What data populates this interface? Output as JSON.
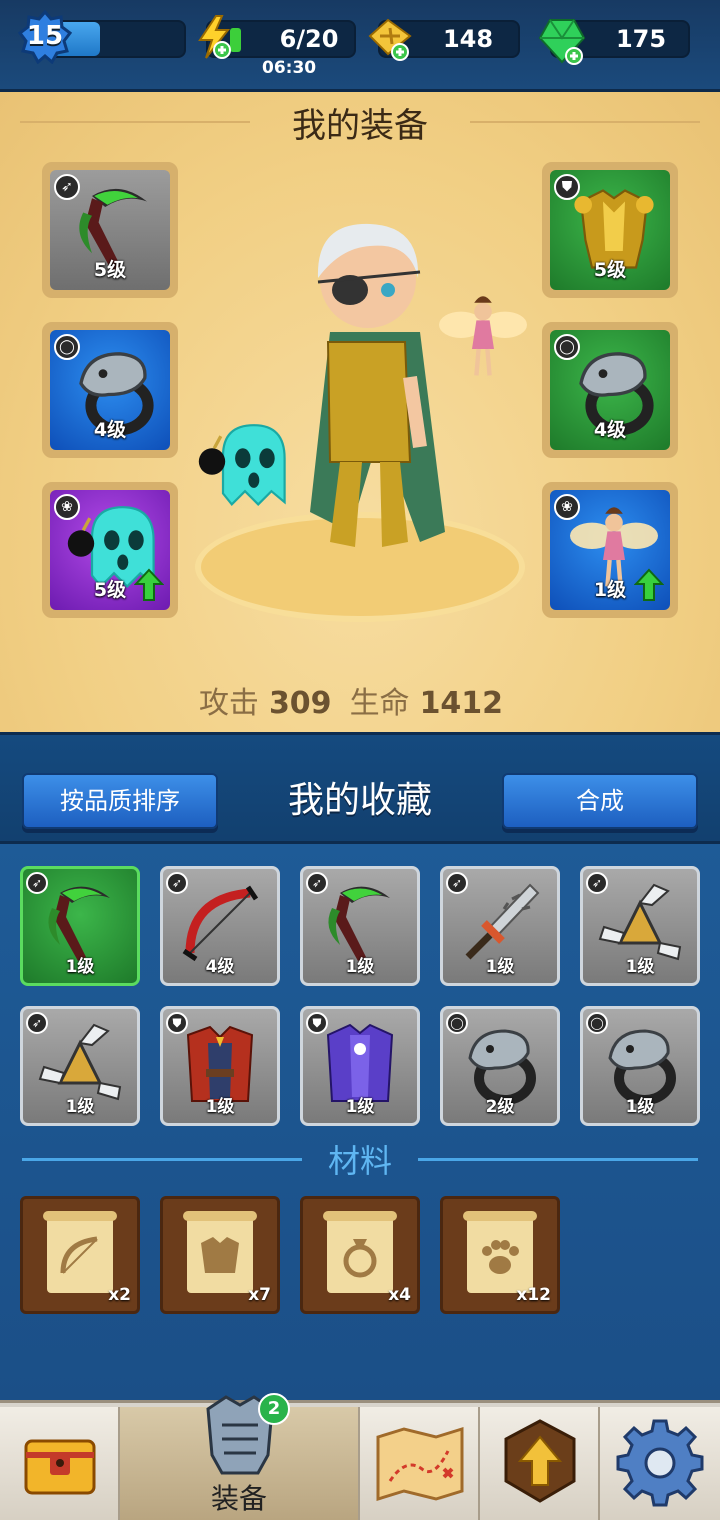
{
  "topbar": {
    "level": "15",
    "level_progress": 0.41,
    "energy": "6/20",
    "energy_timer": "06:30",
    "energy_fill": 0.3,
    "tickets": "148",
    "gems": "175",
    "icons": [
      "level-star-icon",
      "energy-bolt-icon",
      "ticket-icon",
      "gem-icon"
    ]
  },
  "equipment": {
    "title": "我的装备",
    "slots": [
      {
        "level": "5级",
        "rarity": "gray",
        "item": "green-scythe",
        "type": "weapon"
      },
      {
        "level": "5级",
        "rarity": "green",
        "item": "gold-armor",
        "type": "armor"
      },
      {
        "level": "4级",
        "rarity": "blue",
        "item": "snake-ring",
        "type": "ring"
      },
      {
        "level": "4级",
        "rarity": "green",
        "item": "eagle-ring",
        "type": "ring"
      },
      {
        "level": "5级",
        "rarity": "purple",
        "item": "bomb-ghost-pet",
        "type": "pet",
        "upgrade": true
      },
      {
        "level": "1级",
        "rarity": "blue",
        "item": "fairy-pet",
        "type": "pet",
        "upgrade": true
      }
    ],
    "stats": {
      "attack_label": "攻击",
      "attack": "309",
      "hp_label": "生命",
      "hp": "1412"
    }
  },
  "collection": {
    "title": "我的收藏",
    "sort_button": "按品质排序",
    "merge_button": "合成",
    "items": [
      {
        "level": "1级",
        "rarity": "green",
        "item": "green-scythe",
        "type": "weapon"
      },
      {
        "level": "4级",
        "rarity": "gray",
        "item": "red-bow",
        "type": "weapon"
      },
      {
        "level": "1级",
        "rarity": "gray",
        "item": "green-scythe",
        "type": "weapon"
      },
      {
        "level": "1级",
        "rarity": "gray",
        "item": "jagged-sword",
        "type": "weapon"
      },
      {
        "level": "1级",
        "rarity": "gray",
        "item": "shuriken",
        "type": "weapon"
      },
      {
        "level": "1级",
        "rarity": "gray",
        "item": "shuriken",
        "type": "weapon"
      },
      {
        "level": "1级",
        "rarity": "gray",
        "item": "red-vest",
        "type": "armor"
      },
      {
        "level": "1级",
        "rarity": "gray",
        "item": "purple-robe",
        "type": "armor"
      },
      {
        "level": "2级",
        "rarity": "gray",
        "item": "snake-ring",
        "type": "ring"
      },
      {
        "level": "1级",
        "rarity": "gray",
        "item": "snake-ring",
        "type": "ring"
      }
    ],
    "materials_title": "材料",
    "materials": [
      {
        "icon": "bow-scroll-icon",
        "qty": "x2"
      },
      {
        "icon": "armor-scroll-icon",
        "qty": "x7"
      },
      {
        "icon": "ring-scroll-icon",
        "qty": "x4"
      },
      {
        "icon": "paw-scroll-icon",
        "qty": "x12"
      }
    ]
  },
  "nav": {
    "items": [
      {
        "icon": "chest-icon",
        "label": ""
      },
      {
        "icon": "armor-icon",
        "label": "装备",
        "badge": "2",
        "active": true
      },
      {
        "icon": "map-icon",
        "label": ""
      },
      {
        "icon": "upgrade-arrow-icon",
        "label": ""
      },
      {
        "icon": "settings-gear-icon",
        "label": ""
      }
    ]
  }
}
